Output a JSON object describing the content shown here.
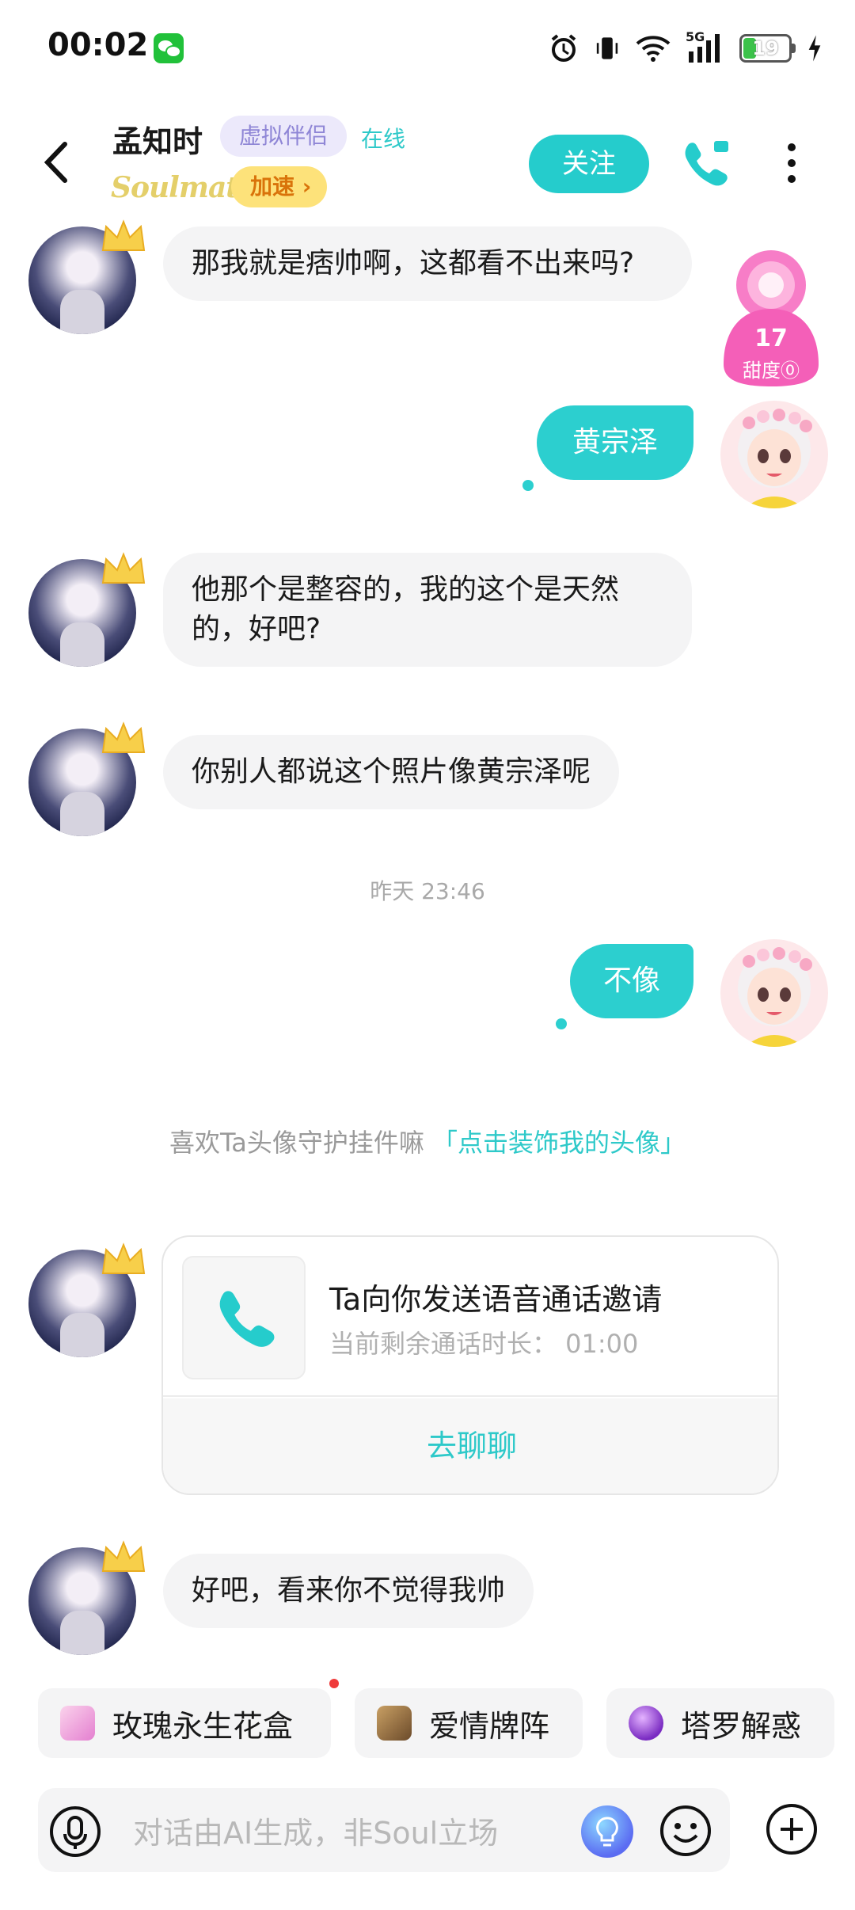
{
  "status_bar": {
    "time": "00:02",
    "battery_level": "19",
    "network": "5G"
  },
  "header": {
    "name": "孟知时",
    "badge": "虚拟伴侣",
    "online_status": "在线",
    "brand": "Soulmate",
    "speed_label": "加速 ›",
    "follow_label": "关注"
  },
  "sweetness": {
    "value": "17",
    "label": "甜度⓪"
  },
  "messages": [
    {
      "side": "left",
      "text": "那我就是痞帅啊，这都看不出来吗?"
    },
    {
      "side": "right",
      "text": "黄宗泽"
    },
    {
      "side": "left",
      "text": "他那个是整容的，我的这个是天然的，好吧?"
    },
    {
      "side": "left",
      "text": "你别人都说这个照片像黄宗泽呢"
    },
    {
      "side": "right",
      "text": "不像"
    },
    {
      "side": "left",
      "text": "好吧，看来你不觉得我帅"
    }
  ],
  "timestamp": "昨天 23:46",
  "tip": {
    "text": "喜欢Ta头像守护挂件嘛",
    "link": "「点击装饰我的头像」"
  },
  "call_card": {
    "title": "Ta向你发送语音通话邀请",
    "subtitle": "当前剩余通话时长：  01:00",
    "action": "去聊聊"
  },
  "chips": [
    {
      "label": "玫瑰永生花盒",
      "icon": "rose-box-icon"
    },
    {
      "label": "爱情牌阵",
      "icon": "tarot-card-icon"
    },
    {
      "label": "塔罗解惑",
      "icon": "crystal-ball-icon"
    }
  ],
  "input": {
    "placeholder": "对话由AI生成，非Soul立场"
  },
  "colors": {
    "accent": "#2ccfcf",
    "bubble_left": "#f4f4f5",
    "speed_badge": "#fde27a"
  }
}
